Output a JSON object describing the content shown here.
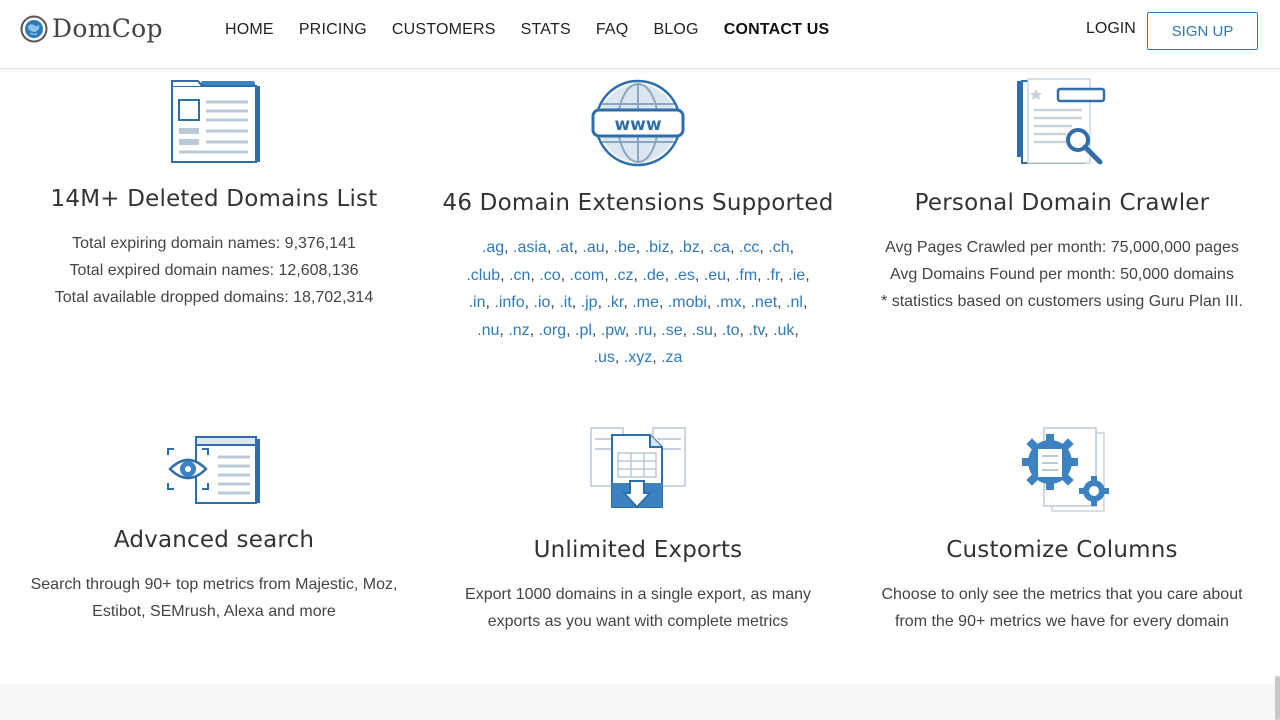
{
  "header": {
    "logo_text": "DomCop",
    "nav": [
      {
        "label": "HOME"
      },
      {
        "label": "PRICING"
      },
      {
        "label": "CUSTOMERS"
      },
      {
        "label": "STATS"
      },
      {
        "label": "FAQ"
      },
      {
        "label": "BLOG"
      },
      {
        "label": "CONTACT US"
      }
    ],
    "active_nav": "CONTACT US",
    "login_label": "LOGIN",
    "signup_label": "SIGN UP"
  },
  "colors": {
    "accent": "#2f7ab8",
    "icon_fill": "#3d82c0",
    "icon_stroke": "#2f6ea8",
    "icon_light": "#dce6f0"
  },
  "features": [
    {
      "icon": "deleted-domains-list-icon",
      "title": "14M+ Deleted Domains List",
      "lines": [
        "Total expiring domain names: 9,376,141",
        "Total expired domain names: 12,608,136",
        "Total available dropped domains: 18,702,314"
      ]
    },
    {
      "icon": "www-globe-icon",
      "title": "46 Domain Extensions Supported",
      "extensions": [
        ".ag",
        ".asia",
        ".at",
        ".au",
        ".be",
        ".biz",
        ".bz",
        ".ca",
        ".cc",
        ".ch",
        ".club",
        ".cn",
        ".co",
        ".com",
        ".cz",
        ".de",
        ".es",
        ".eu",
        ".fm",
        ".fr",
        ".ie",
        ".in",
        ".info",
        ".io",
        ".it",
        ".jp",
        ".kr",
        ".me",
        ".mobi",
        ".mx",
        ".net",
        ".nl",
        ".nu",
        ".nz",
        ".org",
        ".pl",
        ".pw",
        ".ru",
        ".se",
        ".su",
        ".to",
        ".tv",
        ".uk",
        ".us",
        ".xyz",
        ".za"
      ]
    },
    {
      "icon": "document-magnifier-icon",
      "title": "Personal Domain Crawler",
      "lines": [
        "Avg Pages Crawled per month: 75,000,000 pages",
        "Avg Domains Found per month: 50,000 domains",
        "* statistics based on customers using Guru Plan III."
      ]
    },
    {
      "icon": "eye-browser-icon",
      "title": "Advanced search",
      "lines": [
        "Search through 90+ top metrics from Majestic, Moz,",
        "Estibot, SEMrush, Alexa and more"
      ]
    },
    {
      "icon": "export-download-icon",
      "title": "Unlimited Exports",
      "lines": [
        "Export 1000 domains in a single export, as many",
        "exports as you want with complete metrics"
      ]
    },
    {
      "icon": "gear-columns-icon",
      "title": "Customize Columns",
      "lines": [
        "Choose to only see the metrics that you care about",
        "from the 90+ metrics we have for every domain"
      ]
    }
  ]
}
